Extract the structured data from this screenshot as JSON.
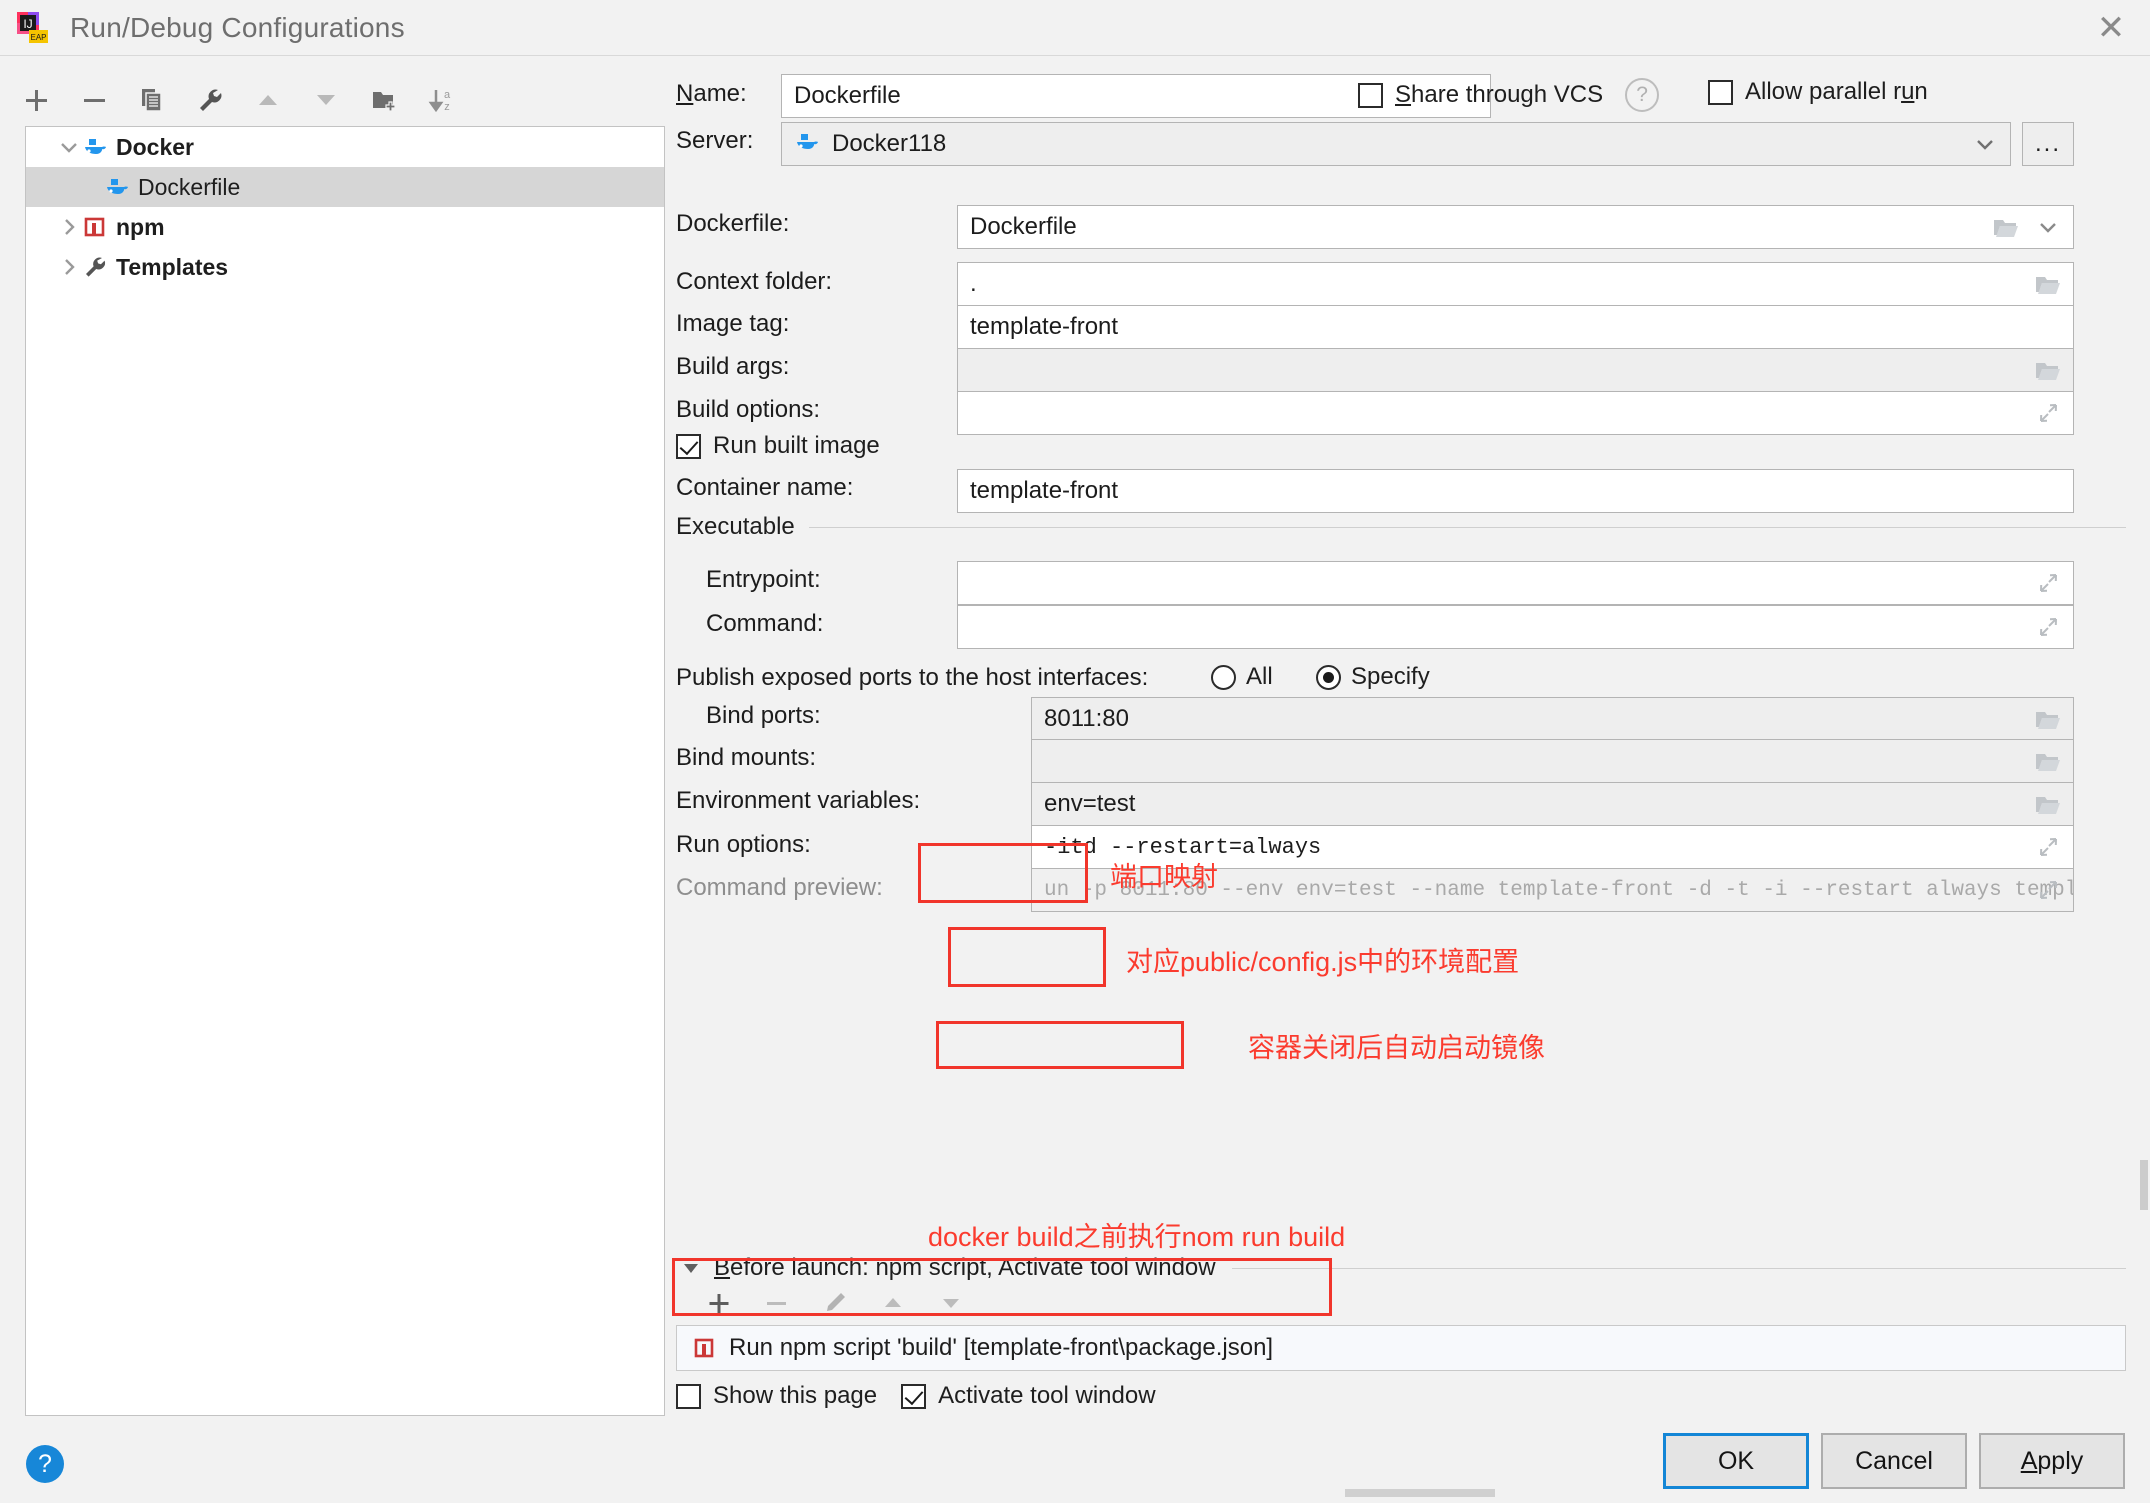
{
  "window": {
    "title": "Run/Debug Configurations",
    "app_icon": "intellij-idea-eap-icon",
    "close_icon": "close-icon"
  },
  "left_panel": {
    "toolbar": [
      {
        "name": "add-configuration-button",
        "icon": "plus-icon"
      },
      {
        "name": "remove-configuration-button",
        "icon": "minus-icon"
      },
      {
        "name": "copy-configuration-button",
        "icon": "copy-icon"
      },
      {
        "name": "edit-templates-button",
        "icon": "wrench-icon"
      },
      {
        "name": "move-up-button",
        "icon": "arrow-up-icon"
      },
      {
        "name": "move-down-button",
        "icon": "arrow-down-icon"
      },
      {
        "name": "new-folder-button",
        "icon": "folder-plus-icon"
      },
      {
        "name": "sort-configurations-button",
        "icon": "sort-az-icon"
      }
    ],
    "tree": [
      {
        "label": "Docker",
        "icon": "docker-icon",
        "level": 0,
        "expanded": true,
        "bold": true,
        "selected": false
      },
      {
        "label": "Dockerfile",
        "icon": "docker-icon",
        "level": 1,
        "expanded": null,
        "bold": false,
        "selected": true
      },
      {
        "label": "npm",
        "icon": "npm-icon",
        "level": 0,
        "expanded": false,
        "bold": true,
        "selected": false
      },
      {
        "label": "Templates",
        "icon": "wrench-icon",
        "level": 0,
        "expanded": false,
        "bold": true,
        "selected": false
      }
    ]
  },
  "form": {
    "name_label": "Name:",
    "name_value": "Dockerfile",
    "share_through_vcs_label": "Share through VCS",
    "share_through_vcs_checked": false,
    "help_icon": "question-circle-icon",
    "allow_parallel_run_label": "Allow parallel run",
    "allow_parallel_run_checked": false,
    "server_label": "Server:",
    "server_value": "Docker118",
    "server_browse_label": "...",
    "dockerfile_label": "Dockerfile:",
    "dockerfile_value": "Dockerfile",
    "context_folder_label": "Context folder:",
    "context_folder_value": ".",
    "image_tag_label": "Image tag:",
    "image_tag_value": "template-front",
    "build_args_label": "Build args:",
    "build_args_value": "",
    "build_options_label": "Build options:",
    "build_options_value": "",
    "run_built_image_label": "Run built image",
    "run_built_image_checked": true,
    "container_name_label": "Container name:",
    "container_name_value": "template-front",
    "executable_section": "Executable",
    "entrypoint_label": "Entrypoint:",
    "entrypoint_value": "",
    "command_label": "Command:",
    "command_value": "",
    "publish_ports_label": "Publish exposed ports to the host interfaces:",
    "publish_all_label": "All",
    "publish_specify_label": "Specify",
    "publish_selected": "Specify",
    "bind_ports_label": "Bind ports:",
    "bind_ports_value": "8011:80",
    "bind_mounts_label": "Bind mounts:",
    "bind_mounts_value": "",
    "env_vars_label": "Environment variables:",
    "env_vars_value": "env=test",
    "run_options_label": "Run options:",
    "run_options_value": "-itd --restart=always",
    "command_preview_label": "Command preview:",
    "command_preview_value": "un -p 8011:80 --env env=test --name template-front -d -t -i --restart always template-front"
  },
  "annotations": {
    "bind_ports_note": "端口映射",
    "env_vars_note": "对应public/config.js中的环境配置",
    "run_options_note": "容器关闭后自动启动镜像",
    "before_launch_note": "docker build之前执行nom run build",
    "color": "#fb3b2e"
  },
  "before_launch": {
    "header": "Before launch: npm script, Activate tool window",
    "expanded": true,
    "toolbar": [
      {
        "name": "add-task-button",
        "icon": "plus-icon"
      },
      {
        "name": "remove-task-button",
        "icon": "minus-icon"
      },
      {
        "name": "edit-task-button",
        "icon": "pencil-icon"
      },
      {
        "name": "move-task-up-button",
        "icon": "arrow-up-icon"
      },
      {
        "name": "move-task-down-button",
        "icon": "arrow-down-icon"
      }
    ],
    "tasks": [
      {
        "icon": "npm-icon",
        "label": "Run npm script 'build' [template-front\\package.json]"
      }
    ],
    "show_this_page_label": "Show this page",
    "show_this_page_checked": false,
    "activate_tool_window_label": "Activate tool window",
    "activate_tool_window_checked": true
  },
  "buttons": {
    "help": "?",
    "ok": "OK",
    "cancel": "Cancel",
    "apply": "Apply"
  },
  "colors": {
    "accent": "#1386d6",
    "annotation_red": "#fb3b2e",
    "docker_blue": "#2396ed",
    "npm_red": "#cb3837"
  }
}
